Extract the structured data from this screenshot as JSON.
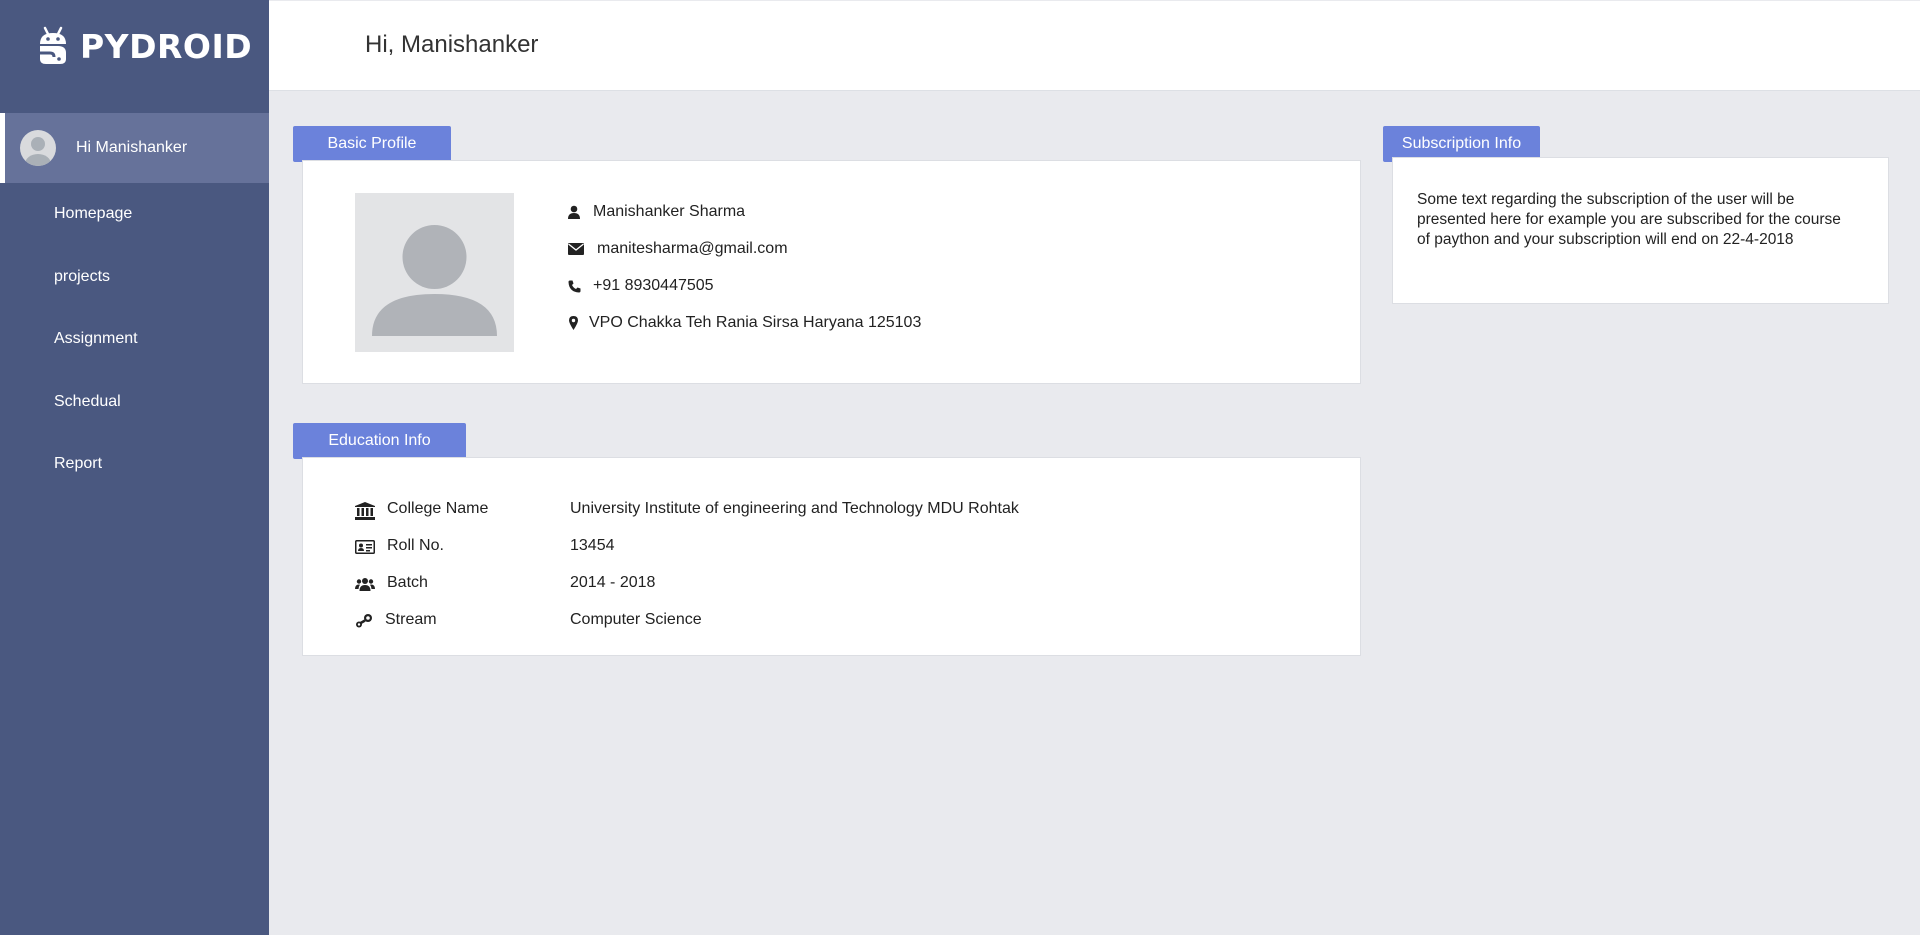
{
  "app": {
    "brand": "PYDROID"
  },
  "sidebar": {
    "user_greeting": "Hi Manishanker",
    "items": [
      {
        "label": "Homepage"
      },
      {
        "label": "projects"
      },
      {
        "label": "Assignment"
      },
      {
        "label": "Schedual"
      },
      {
        "label": "Report"
      }
    ]
  },
  "header": {
    "title": "Hi, Manishanker"
  },
  "basic_profile": {
    "tab_label": "Basic Profile",
    "name": "Manishanker Sharma",
    "email": "manitesharma@gmail.com",
    "phone": "+91 8930447505",
    "address": "VPO Chakka Teh Rania Sirsa Haryana 125103"
  },
  "subscription": {
    "tab_label": "Subscription Info",
    "text": "Some text regarding the subscription of the user will be presented here for example you are subscribed for the course of paython and your subscription will end on 22-4-2018"
  },
  "education": {
    "tab_label": "Education Info",
    "rows": [
      {
        "label": "College Name",
        "value": "University Institute of engineering and Technology MDU Rohtak",
        "icon": "university-icon"
      },
      {
        "label": "Roll No.",
        "value": "13454",
        "icon": "id-card-icon"
      },
      {
        "label": "Batch",
        "value": "2014 - 2018",
        "icon": "users-icon"
      },
      {
        "label": "Stream",
        "value": "Computer Science",
        "icon": "steam-icon"
      }
    ]
  },
  "colors": {
    "sidebar": "#4a5880",
    "sidebar_active": "#66729a",
    "accent": "#6b82db",
    "background": "#e9eaee"
  }
}
